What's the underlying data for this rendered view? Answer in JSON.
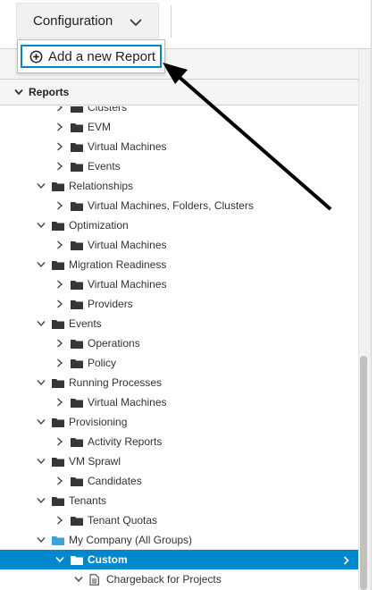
{
  "toolbar": {
    "config_label": "Configuration"
  },
  "dropdown": {
    "add_report_label": "Add a new Report"
  },
  "accordion": {
    "reports_label": "Reports"
  },
  "tree": [
    {
      "label": "Clusters",
      "level": 2,
      "type": "folder",
      "expand": "collapsed"
    },
    {
      "label": "EVM",
      "level": 2,
      "type": "folder",
      "expand": "collapsed"
    },
    {
      "label": "Virtual Machines",
      "level": 2,
      "type": "folder",
      "expand": "collapsed"
    },
    {
      "label": "Events",
      "level": 2,
      "type": "folder",
      "expand": "collapsed"
    },
    {
      "label": "Relationships",
      "level": 1,
      "type": "folder",
      "expand": "expanded"
    },
    {
      "label": "Virtual Machines, Folders, Clusters",
      "level": 2,
      "type": "folder",
      "expand": "collapsed"
    },
    {
      "label": "Optimization",
      "level": 1,
      "type": "folder",
      "expand": "expanded"
    },
    {
      "label": "Virtual Machines",
      "level": 2,
      "type": "folder",
      "expand": "collapsed"
    },
    {
      "label": "Migration Readiness",
      "level": 1,
      "type": "folder",
      "expand": "expanded"
    },
    {
      "label": "Virtual Machines",
      "level": 2,
      "type": "folder",
      "expand": "collapsed"
    },
    {
      "label": "Providers",
      "level": 2,
      "type": "folder",
      "expand": "collapsed"
    },
    {
      "label": "Events",
      "level": 1,
      "type": "folder",
      "expand": "expanded"
    },
    {
      "label": "Operations",
      "level": 2,
      "type": "folder",
      "expand": "collapsed"
    },
    {
      "label": "Policy",
      "level": 2,
      "type": "folder",
      "expand": "collapsed"
    },
    {
      "label": "Running Processes",
      "level": 1,
      "type": "folder",
      "expand": "expanded"
    },
    {
      "label": "Virtual Machines",
      "level": 2,
      "type": "folder",
      "expand": "collapsed"
    },
    {
      "label": "Provisioning",
      "level": 1,
      "type": "folder",
      "expand": "expanded"
    },
    {
      "label": "Activity Reports",
      "level": 2,
      "type": "folder",
      "expand": "collapsed"
    },
    {
      "label": "VM Sprawl",
      "level": 1,
      "type": "folder",
      "expand": "expanded"
    },
    {
      "label": "Candidates",
      "level": 2,
      "type": "folder",
      "expand": "collapsed"
    },
    {
      "label": "Tenants",
      "level": 1,
      "type": "folder",
      "expand": "expanded"
    },
    {
      "label": "Tenant Quotas",
      "level": 2,
      "type": "folder",
      "expand": "collapsed"
    },
    {
      "label": "My Company (All Groups)",
      "level": 1,
      "type": "folder-blue",
      "expand": "expanded"
    },
    {
      "label": "Custom",
      "level": 2,
      "type": "folder-white",
      "expand": "expanded",
      "selected": true
    },
    {
      "label": "Chargeback for Projects",
      "level": 3,
      "type": "document",
      "expand": "expanded"
    }
  ],
  "colors": {
    "selected_bg": "#0088ce",
    "folder": "#363636",
    "folder_blue": "#39a5dc",
    "focus_border": "#0088ce"
  }
}
